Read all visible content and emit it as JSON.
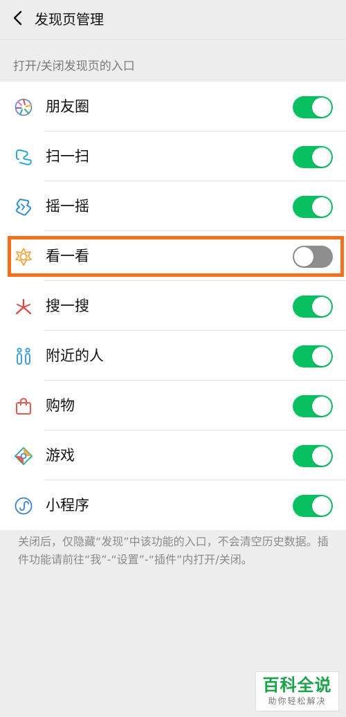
{
  "nav": {
    "title": "发现页管理",
    "back_icon": "chevron-left-icon"
  },
  "section": {
    "header": "打开/关闭发现页的入口"
  },
  "items": [
    {
      "label": "朋友圈",
      "icon": "moments-icon",
      "enabled": true
    },
    {
      "label": "扫一扫",
      "icon": "scan-icon",
      "enabled": true
    },
    {
      "label": "摇一摇",
      "icon": "shake-icon",
      "enabled": true
    },
    {
      "label": "看一看",
      "icon": "top-stories-icon",
      "enabled": false
    },
    {
      "label": "搜一搜",
      "icon": "search-sparkle-icon",
      "enabled": true
    },
    {
      "label": "附近的人",
      "icon": "people-nearby-icon",
      "enabled": true
    },
    {
      "label": "购物",
      "icon": "shopping-bag-icon",
      "enabled": true
    },
    {
      "label": "游戏",
      "icon": "games-icon",
      "enabled": true
    },
    {
      "label": "小程序",
      "icon": "mini-programs-icon",
      "enabled": true
    }
  ],
  "footer": {
    "note": "关闭后，仅隐藏“发现”中该功能的入口，不会清空历史数据。插件功能请前往“我”-“设置”-“插件”内打开/关闭。"
  },
  "watermark": {
    "main": "百科全说",
    "sub": "助你轻松解决"
  },
  "colors": {
    "toggle_on": "#07c160",
    "toggle_off": "#8e8e8e",
    "highlight": "#f4701f",
    "background": "#ededed"
  }
}
